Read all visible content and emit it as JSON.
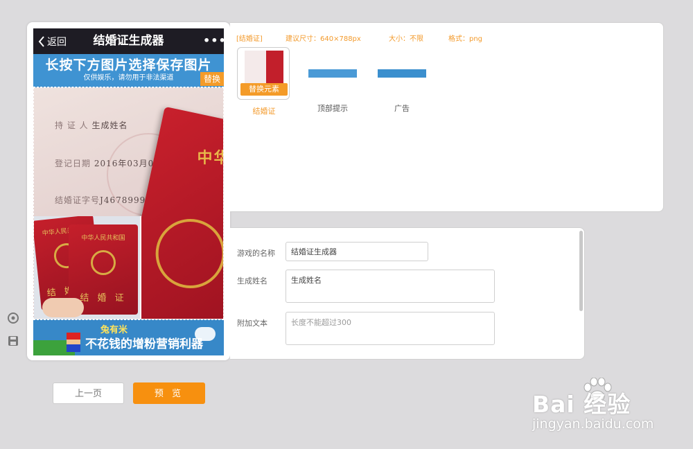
{
  "phone": {
    "nav": {
      "back_label": "返回",
      "title": "结婚证生成器",
      "more": "•••"
    },
    "top_banner": {
      "line1": "长按下方图片选择保存图片",
      "line2": "仅供娱乐，请勿用于非法渠道"
    },
    "replace_tag": "替换",
    "certificate": {
      "holder_label": "持 证 人",
      "holder_value": "生成姓名",
      "date_label": "登记日期",
      "date_value": "2016年03月07日",
      "number_label": "结婚证字号",
      "number_value": "J4678999-1",
      "book_big_text": "中华",
      "book_small_title": "中华人民共和国",
      "book_small_text": "结 婚 证"
    },
    "bottom_ad": {
      "line1": "兔有米",
      "line2": "不花钱的增粉营销利器"
    }
  },
  "assets_panel": {
    "category": "[结婚证]",
    "suggested_size": "建议尺寸：640×788px",
    "size_limit": "大小：不限",
    "format": "格式：png",
    "items": [
      {
        "label": "结婚证",
        "replace_button": "替换元素",
        "active": true
      },
      {
        "label": "顶部提示"
      },
      {
        "label": "广告"
      }
    ]
  },
  "form": {
    "game_name_label": "游戏的名称",
    "game_name_value": "结婚证生成器",
    "gen_name_label": "生成姓名",
    "gen_name_value": "生成姓名",
    "extra_text_label": "附加文本",
    "extra_text_placeholder": "长度不能超过300"
  },
  "buttons": {
    "prev": "上一页",
    "preview": "预 览"
  },
  "watermark": {
    "brand": "Bai 经验",
    "site": "jingyan.baidu.com"
  },
  "colors": {
    "accent": "#f7900f",
    "nav": "#1e1c24",
    "banner": "#3f93d2"
  }
}
